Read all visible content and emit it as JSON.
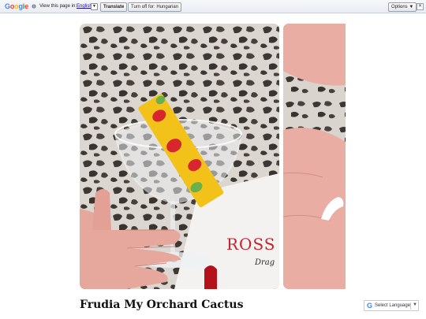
{
  "translate_bar": {
    "logo_letters": [
      "G",
      "o",
      "o",
      "g",
      "l",
      "e"
    ],
    "prompt": "View this page in:",
    "language": "English",
    "language_arrow": "▼",
    "translate_label": "Translate",
    "turn_off_label": "Turn off for: Hungarian",
    "options_label": "Options ▼",
    "close_label": "✕",
    "info_icon": "info-icon"
  },
  "gallery": {
    "photo_1": {
      "brand_text": "ROSS",
      "script_text": "Drag",
      "colors": {
        "wall_bg": "#d9d4ce",
        "spots": "#3e3835",
        "package": "#f2c21b",
        "strawberry": "#d8262e",
        "skin": "#e6a79d"
      }
    },
    "photo_2": {
      "colors": {
        "wall_bg": "#d9d4ce",
        "spots": "#3e3835",
        "skin": "#e9ada3",
        "cream": "#ffffff"
      }
    }
  },
  "post": {
    "title": "Frudia My Orchard Cactus"
  },
  "language_widget": {
    "g_icon": "G",
    "label": "Select Language",
    "arrow": "▼"
  }
}
